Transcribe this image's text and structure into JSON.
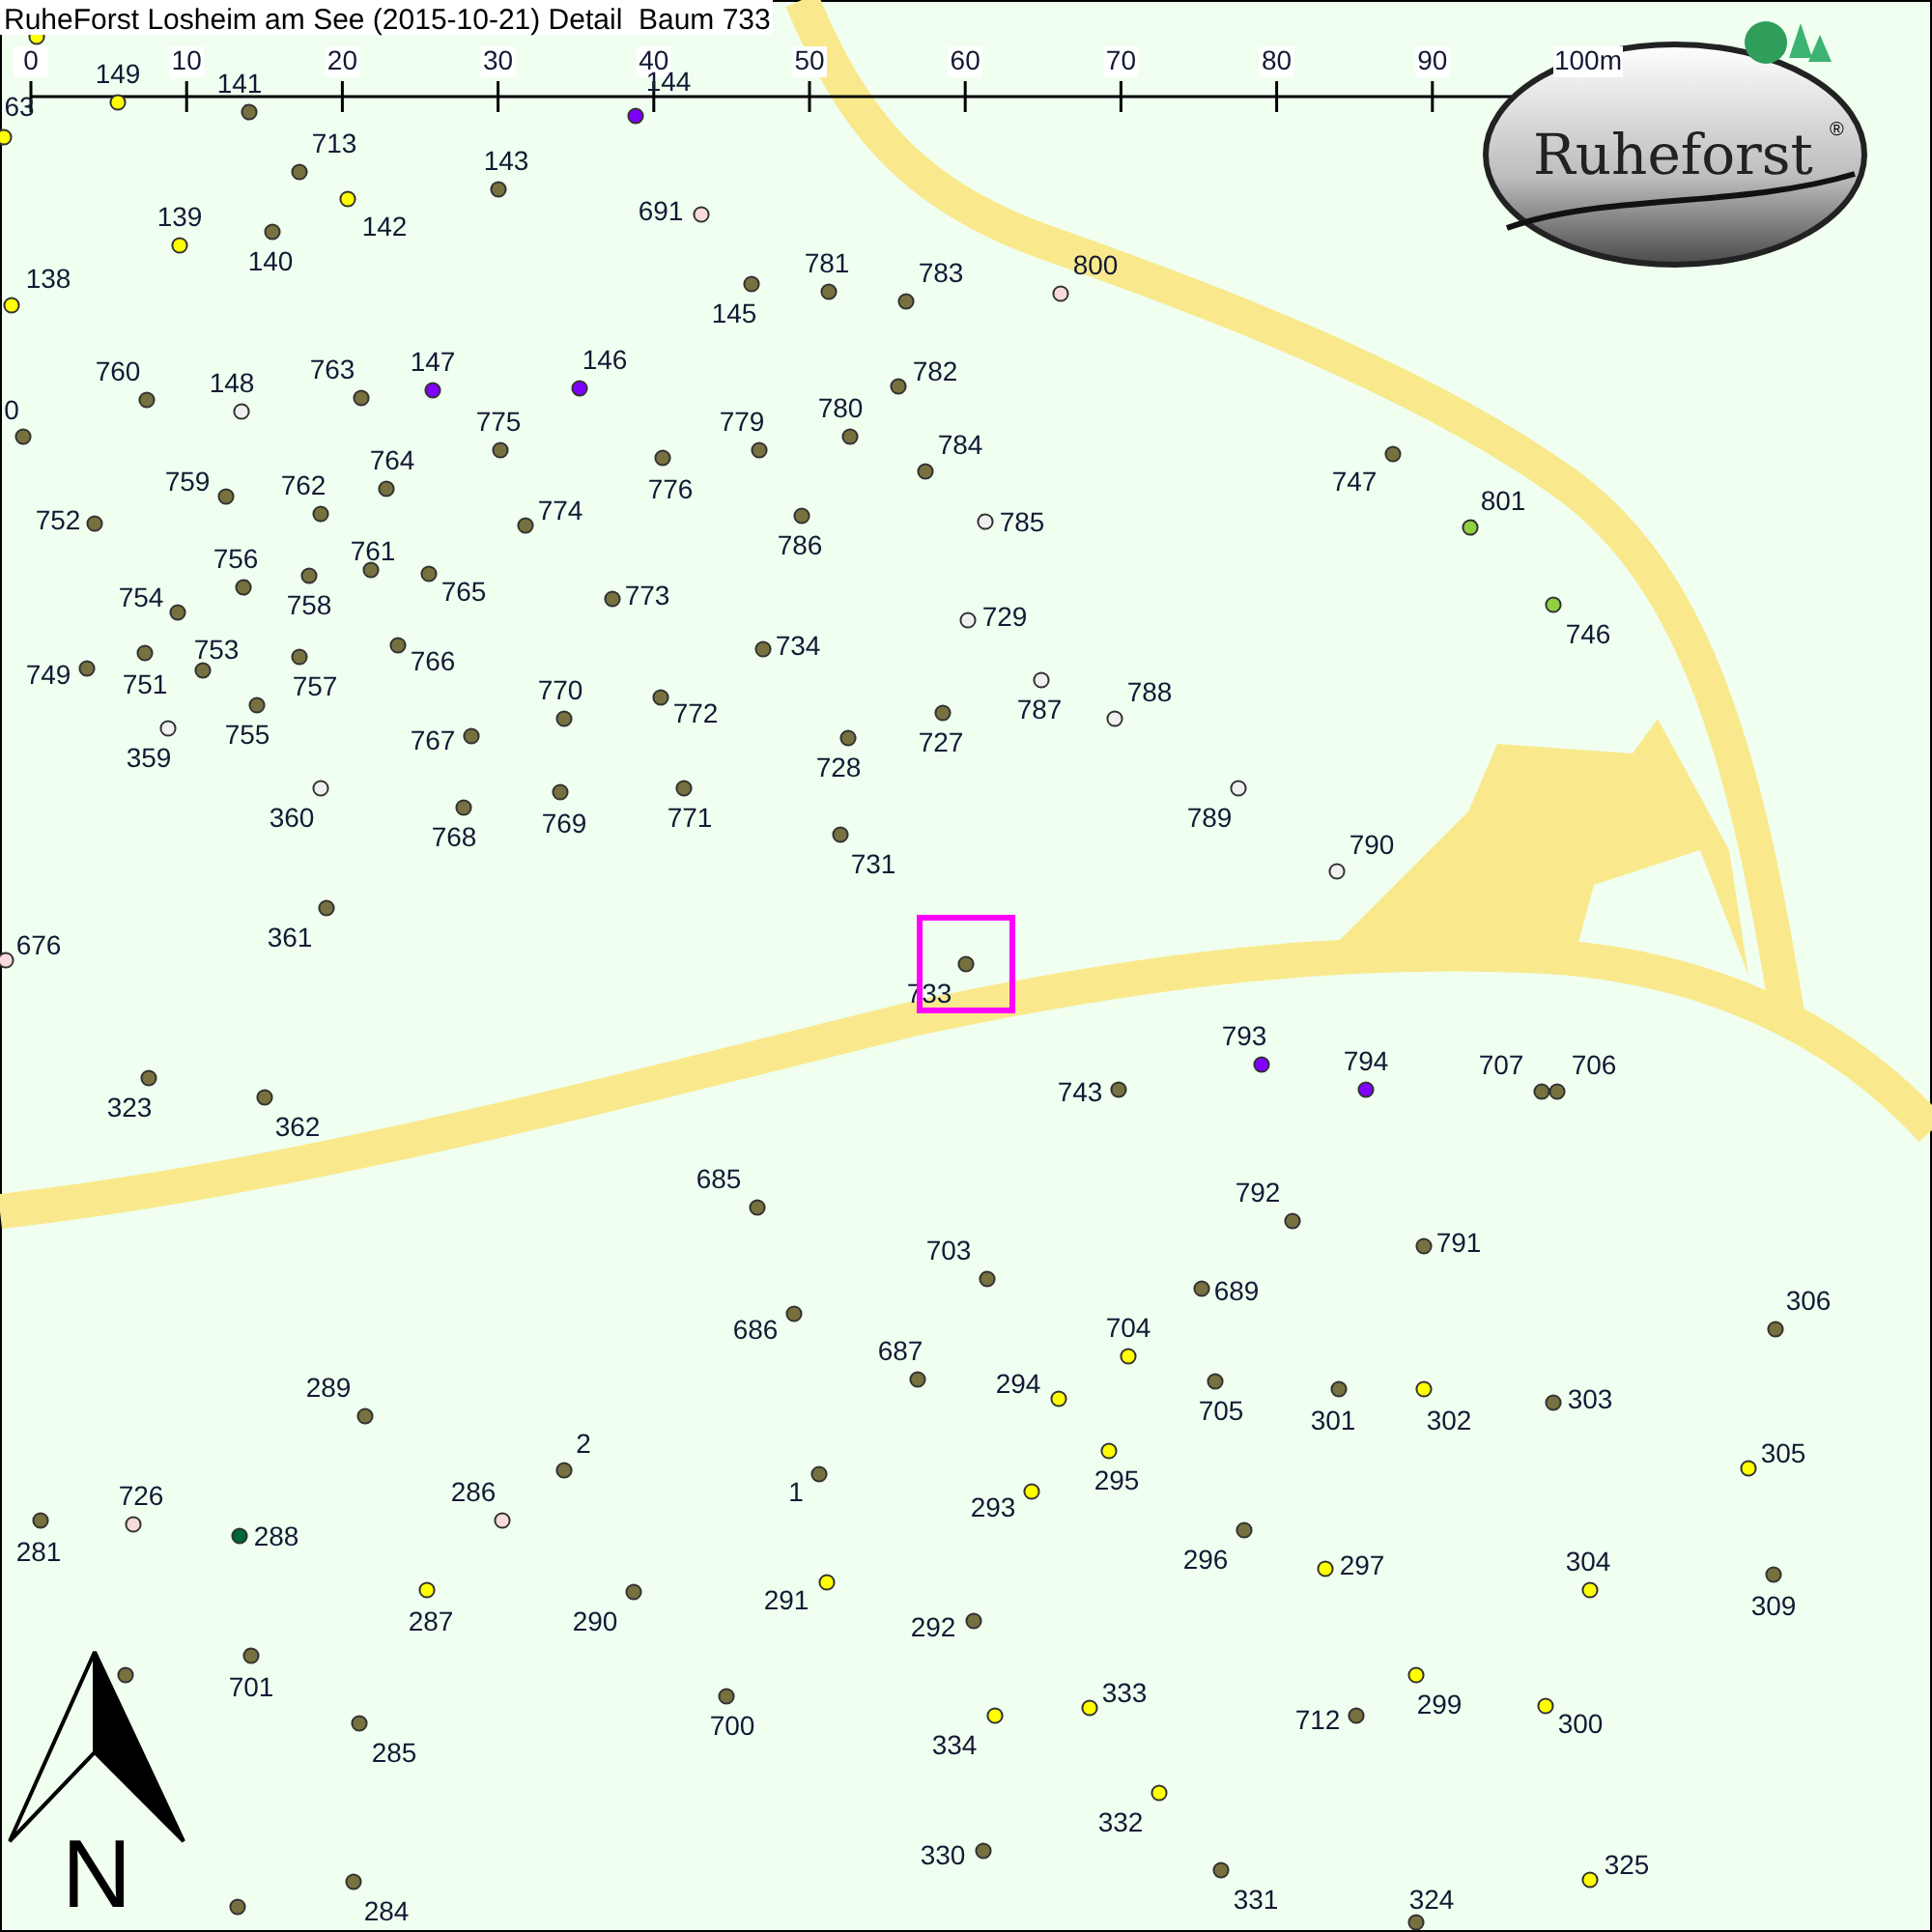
{
  "title": "RuheForst Losheim am See (2015-10-21) Detail  Baum 733",
  "scale_bar": {
    "ticks": [
      "0",
      "10",
      "20",
      "30",
      "40",
      "50",
      "60",
      "70",
      "80",
      "90",
      "100m"
    ]
  },
  "logo": {
    "text": "Ruheforst",
    "mark": "®"
  },
  "north_arrow": {
    "label": "N"
  },
  "trees": [
    {
      "color": "#ffff00",
      "selected": false
    },
    {
      "label": "63",
      "color": "#ffff00",
      "selected": false
    },
    {
      "label": "149",
      "color": "#ffff00",
      "selected": false
    },
    {
      "label": "141",
      "color": "#77703f",
      "selected": false
    },
    {
      "label": "144",
      "color": "#8000ff",
      "selected": false
    },
    {
      "label": "713",
      "color": "#77703f",
      "selected": false
    },
    {
      "label": "143",
      "color": "#77703f",
      "selected": false
    },
    {
      "label": "142",
      "color": "#ffff00",
      "selected": false
    },
    {
      "label": "139",
      "color": "#ffff00",
      "selected": false
    },
    {
      "label": "140",
      "color": "#77703f",
      "selected": false
    },
    {
      "label": "691",
      "color": "#f8dada",
      "selected": false
    },
    {
      "label": "138",
      "color": "#ffff00",
      "selected": false
    },
    {
      "label": "145",
      "color": "#77703f",
      "selected": false
    },
    {
      "label": "781",
      "color": "#77703f",
      "selected": false
    },
    {
      "label": "783",
      "color": "#77703f",
      "selected": false
    },
    {
      "label": "800",
      "color": "#f8dada",
      "selected": false
    },
    {
      "label": "0",
      "color": "#77703f",
      "selected": false
    },
    {
      "label": "760",
      "color": "#77703f",
      "selected": false
    },
    {
      "label": "148",
      "color": "#f0f0f0",
      "selected": false
    },
    {
      "label": "763",
      "color": "#77703f",
      "selected": false
    },
    {
      "label": "147",
      "color": "#8000ff",
      "selected": false
    },
    {
      "label": "146",
      "color": "#8000ff",
      "selected": false
    },
    {
      "label": "775",
      "color": "#77703f",
      "selected": false
    },
    {
      "label": "779",
      "color": "#77703f",
      "selected": false
    },
    {
      "label": "780",
      "color": "#77703f",
      "selected": false
    },
    {
      "label": "782",
      "color": "#77703f",
      "selected": false
    },
    {
      "label": "776",
      "color": "#77703f",
      "selected": false
    },
    {
      "label": "784",
      "color": "#77703f",
      "selected": false
    },
    {
      "label": "747",
      "color": "#77703f",
      "selected": false
    },
    {
      "label": "801",
      "color": "#90d040",
      "selected": false
    },
    {
      "label": "759",
      "color": "#77703f",
      "selected": false
    },
    {
      "label": "762",
      "color": "#77703f",
      "selected": false
    },
    {
      "label": "764",
      "color": "#77703f",
      "selected": false
    },
    {
      "label": "752",
      "color": "#77703f",
      "selected": false
    },
    {
      "label": "774",
      "color": "#77703f",
      "selected": false
    },
    {
      "label": "786",
      "color": "#77703f",
      "selected": false
    },
    {
      "label": "785",
      "color": "#f0f0f0",
      "selected": false
    },
    {
      "label": "754",
      "color": "#77703f",
      "selected": false
    },
    {
      "label": "756",
      "color": "#77703f",
      "selected": false
    },
    {
      "label": "758",
      "color": "#77703f",
      "selected": false
    },
    {
      "label": "761",
      "color": "#77703f",
      "selected": false
    },
    {
      "label": "765",
      "color": "#77703f",
      "selected": false
    },
    {
      "label": "773",
      "color": "#77703f",
      "selected": false
    },
    {
      "label": "729",
      "color": "#f0f0f0",
      "selected": false
    },
    {
      "label": "746",
      "color": "#90d040",
      "selected": false
    },
    {
      "label": "753",
      "color": "#77703f",
      "selected": false
    },
    {
      "label": "751",
      "color": "#77703f",
      "selected": false
    },
    {
      "label": "749",
      "color": "#77703f",
      "selected": false
    },
    {
      "label": "757",
      "color": "#77703f",
      "selected": false
    },
    {
      "label": "766",
      "color": "#77703f",
      "selected": false
    },
    {
      "label": "734",
      "color": "#77703f",
      "selected": false
    },
    {
      "label": "770",
      "color": "#77703f",
      "selected": false
    },
    {
      "label": "772",
      "color": "#77703f",
      "selected": false
    },
    {
      "label": "787",
      "color": "#f0f0f0",
      "selected": false
    },
    {
      "label": "788",
      "color": "#f0f0f0",
      "selected": false
    },
    {
      "label": "727",
      "color": "#77703f",
      "selected": false
    },
    {
      "label": "728",
      "color": "#77703f",
      "selected": false
    },
    {
      "label": "755",
      "color": "#77703f",
      "selected": false
    },
    {
      "label": "767",
      "color": "#77703f",
      "selected": false
    },
    {
      "label": "359",
      "color": "#f0f0f0",
      "selected": false
    },
    {
      "label": "360",
      "color": "#f0f0f0",
      "selected": false
    },
    {
      "label": "768",
      "color": "#77703f",
      "selected": false
    },
    {
      "label": "769",
      "color": "#77703f",
      "selected": false
    },
    {
      "label": "771",
      "color": "#77703f",
      "selected": false
    },
    {
      "label": "789",
      "color": "#f0f0f0",
      "selected": false
    },
    {
      "label": "731",
      "color": "#77703f",
      "selected": false
    },
    {
      "label": "790",
      "color": "#f0f0f0",
      "selected": false
    },
    {
      "label": "361",
      "color": "#77703f",
      "selected": false
    },
    {
      "label": "676",
      "color": "#f8dada",
      "selected": false
    },
    {
      "label": "733",
      "color": "#77703f",
      "selected": true
    },
    {
      "label": "323",
      "color": "#77703f",
      "selected": false
    },
    {
      "label": "362",
      "color": "#77703f",
      "selected": false
    },
    {
      "label": "793",
      "color": "#8000ff",
      "selected": false
    },
    {
      "label": "794",
      "color": "#8000ff",
      "selected": false
    },
    {
      "label": "743",
      "color": "#77703f",
      "selected": false
    },
    {
      "label": "707",
      "color": "#77703f",
      "selected": false
    },
    {
      "label": "706",
      "color": "#77703f",
      "selected": false
    },
    {
      "label": "685",
      "color": "#77703f",
      "selected": false
    },
    {
      "label": "792",
      "color": "#77703f",
      "selected": false
    },
    {
      "label": "791",
      "color": "#77703f",
      "selected": false
    },
    {
      "label": "703",
      "color": "#77703f",
      "selected": false
    },
    {
      "label": "689",
      "color": "#77703f",
      "selected": false
    },
    {
      "label": "306",
      "color": "#77703f",
      "selected": false
    },
    {
      "label": "686",
      "color": "#77703f",
      "selected": false
    },
    {
      "label": "704",
      "color": "#ffff00",
      "selected": false
    },
    {
      "label": "687",
      "color": "#77703f",
      "selected": false
    },
    {
      "label": "294",
      "color": "#ffff00",
      "selected": false
    },
    {
      "label": "705",
      "color": "#77703f",
      "selected": false
    },
    {
      "label": "301",
      "color": "#77703f",
      "selected": false
    },
    {
      "label": "302",
      "color": "#ffff00",
      "selected": false
    },
    {
      "label": "303",
      "color": "#77703f",
      "selected": false
    },
    {
      "label": "289",
      "color": "#77703f",
      "selected": false
    },
    {
      "label": "2",
      "color": "#77703f",
      "selected": false
    },
    {
      "label": "1",
      "color": "#77703f",
      "selected": false
    },
    {
      "label": "295",
      "color": "#ffff00",
      "selected": false
    },
    {
      "label": "305",
      "color": "#ffff00",
      "selected": false
    },
    {
      "label": "293",
      "color": "#ffff00",
      "selected": false
    },
    {
      "label": "726",
      "color": "#f8dada",
      "selected": false
    },
    {
      "label": "281",
      "color": "#77703f",
      "selected": false
    },
    {
      "label": "288",
      "color": "#006633",
      "selected": false
    },
    {
      "label": "286",
      "color": "#f8dada",
      "selected": false
    },
    {
      "label": "296",
      "color": "#77703f",
      "selected": false
    },
    {
      "label": "297",
      "color": "#ffff00",
      "selected": false
    },
    {
      "label": "304",
      "color": "#ffff00",
      "selected": false
    },
    {
      "label": "309",
      "color": "#77703f",
      "selected": false
    },
    {
      "label": "287",
      "color": "#ffff00",
      "selected": false
    },
    {
      "label": "290",
      "color": "#77703f",
      "selected": false
    },
    {
      "label": "291",
      "color": "#ffff00",
      "selected": false
    },
    {
      "label": "292",
      "color": "#77703f",
      "selected": false
    },
    {
      "color": "#77703f",
      "selected": false
    },
    {
      "label": "701",
      "color": "#77703f",
      "selected": false
    },
    {
      "label": "700",
      "color": "#77703f",
      "selected": false
    },
    {
      "label": "333",
      "color": "#ffff00",
      "selected": false
    },
    {
      "label": "334",
      "color": "#ffff00",
      "selected": false
    },
    {
      "label": "712",
      "color": "#77703f",
      "selected": false
    },
    {
      "label": "299",
      "color": "#ffff00",
      "selected": false
    },
    {
      "label": "300",
      "color": "#ffff00",
      "selected": false
    },
    {
      "label": "285",
      "color": "#77703f",
      "selected": false
    },
    {
      "label": "332",
      "color": "#ffff00",
      "selected": false
    },
    {
      "label": "330",
      "color": "#77703f",
      "selected": false
    },
    {
      "label": "331",
      "color": "#77703f",
      "selected": false
    },
    {
      "label": "324",
      "color": "#77703f",
      "selected": false
    },
    {
      "label": "325",
      "color": "#ffff00",
      "selected": false
    },
    {
      "label": "284",
      "color": "#77703f",
      "selected": false
    },
    {
      "color": "#77703f",
      "selected": false
    }
  ]
}
